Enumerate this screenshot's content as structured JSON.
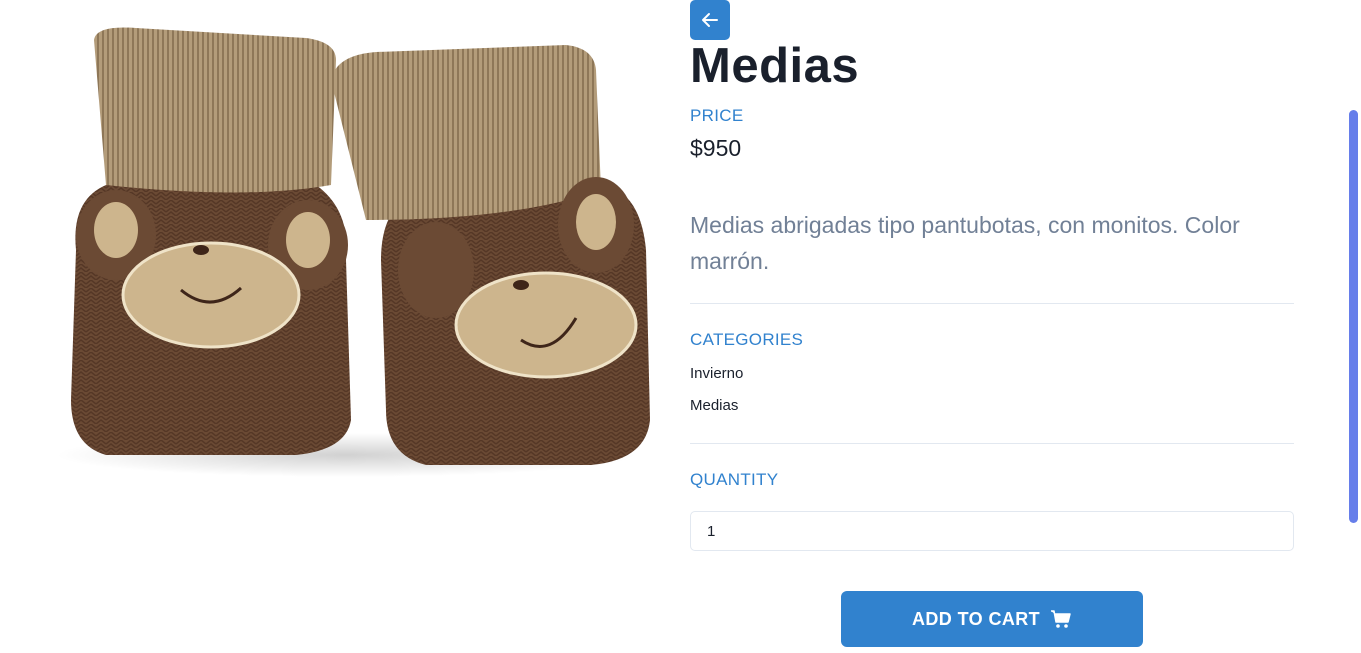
{
  "product": {
    "title": "Medias",
    "price_label": "PRICE",
    "price": "$950",
    "description": "Medias abrigadas tipo pantubotas, con monitos. Color marrón.",
    "image_icon": "knitted-baby-booties-image"
  },
  "categories": {
    "label": "CATEGORIES",
    "items": [
      "Invierno",
      "Medias"
    ]
  },
  "quantity": {
    "label": "QUANTITY",
    "value": "1"
  },
  "actions": {
    "add_to_cart": "ADD TO CART",
    "back_icon": "arrow-left-icon",
    "cart_icon": "shopping-cart-icon"
  },
  "colors": {
    "accent": "#3182ce",
    "title": "#1a202c",
    "muted": "#718096",
    "scrollbar": "#667eea"
  }
}
